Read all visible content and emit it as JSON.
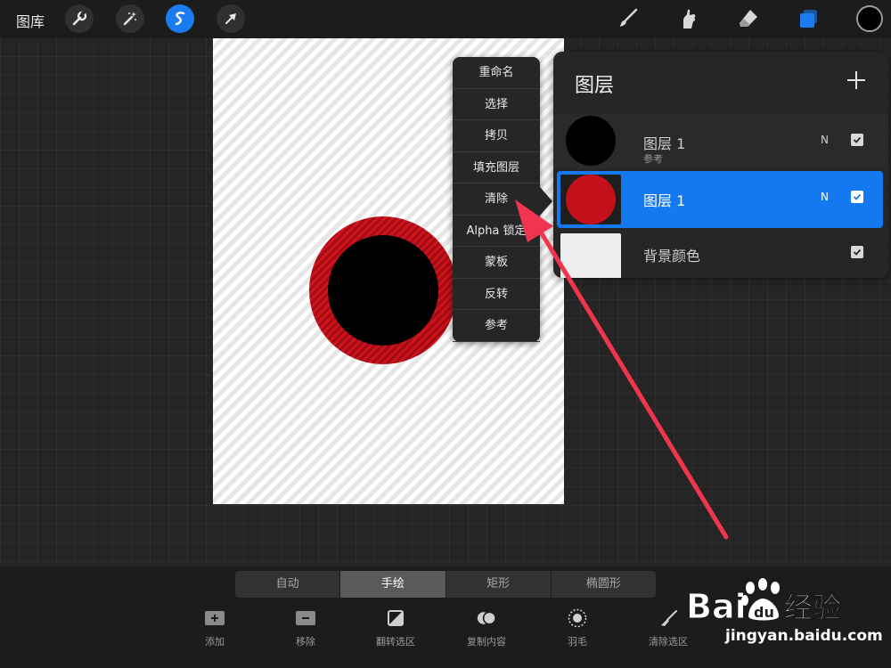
{
  "topbar": {
    "gallery_label": "图库",
    "left_tools": [
      "wrench-icon",
      "magic-wand-icon",
      "selection-icon",
      "transform-arrow-icon"
    ],
    "active_tool": "selection-icon",
    "right_tools": [
      "brush-icon",
      "smudge-icon",
      "eraser-icon",
      "layers-icon"
    ],
    "current_color": "#000000",
    "accent": "#1a7cf0"
  },
  "canvas": {
    "background": "#f1f1f1",
    "ring_color": "#c4101a",
    "disc_color": "#000000"
  },
  "context_menu": {
    "items": [
      "重命名",
      "选择",
      "拷贝",
      "填充图层",
      "清除",
      "Alpha 锁定",
      "蒙板",
      "反转",
      "参考"
    ]
  },
  "layers_panel": {
    "title": "图层",
    "add_icon": "plus-icon",
    "layers": [
      {
        "name": "图层 1",
        "sub": "参考",
        "blend": "N",
        "visible": true,
        "thumb": "#000000",
        "selected": false
      },
      {
        "name": "图层 1",
        "sub": "",
        "blend": "N",
        "visible": true,
        "thumb": "#c4101a",
        "selected": true
      },
      {
        "name": "背景颜色",
        "sub": "",
        "blend": "",
        "visible": true,
        "thumb": "#ededed",
        "selected": false
      }
    ]
  },
  "selection_modes": {
    "tabs": [
      "自动",
      "手绘",
      "矩形",
      "椭圆形"
    ],
    "active": "手绘"
  },
  "selection_actions": [
    {
      "label": "添加",
      "icon": "add-icon"
    },
    {
      "label": "移除",
      "icon": "remove-icon"
    },
    {
      "label": "翻转选区",
      "icon": "invert-selection-icon"
    },
    {
      "label": "复制内容",
      "icon": "copy-paste-icon"
    },
    {
      "label": "羽毛",
      "icon": "feather-icon"
    },
    {
      "label": "清除选区",
      "icon": "clear-selection-icon"
    }
  ],
  "watermark": {
    "brand": "Bai du 经验",
    "url": "jingyan.baidu.com"
  },
  "annotation": {
    "arrow_color": "#f0354e"
  }
}
